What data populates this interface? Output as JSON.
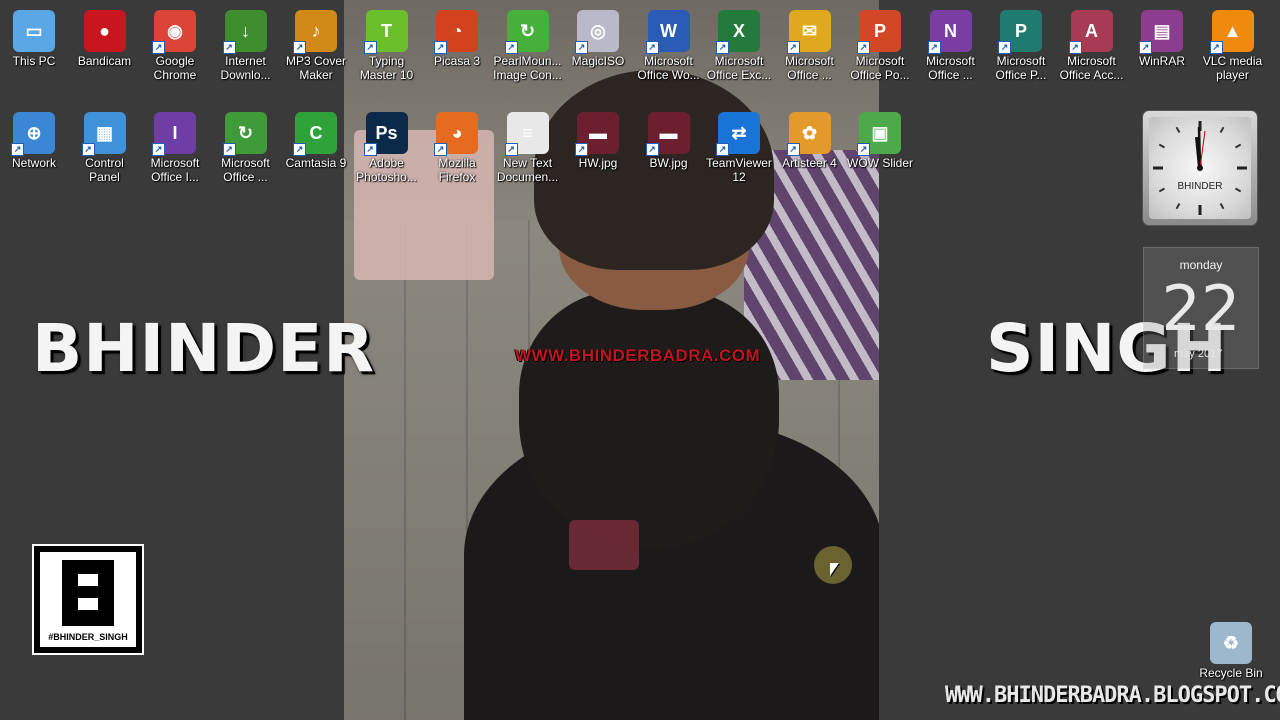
{
  "desktop": {
    "row1": [
      {
        "label": "This PC",
        "icon": "this-pc-icon",
        "color": "#5ba7e6",
        "glyph": "▭"
      },
      {
        "label": "Bandicam",
        "icon": "bandicam-icon",
        "color": "#c9151e",
        "glyph": "●"
      },
      {
        "label": "Google\nChrome",
        "icon": "chrome-icon",
        "color": "#db4437",
        "glyph": "◉"
      },
      {
        "label": "Internet\nDownlo...",
        "icon": "idm-icon",
        "color": "#3e8e2e",
        "glyph": "↓"
      },
      {
        "label": "MP3 Cover\nMaker",
        "icon": "mp3-cover-icon",
        "color": "#d18a18",
        "glyph": "♪"
      },
      {
        "label": "Typing\nMaster 10",
        "icon": "typing-master-icon",
        "color": "#6bbf2a",
        "glyph": "T"
      },
      {
        "label": "Picasa 3",
        "icon": "picasa-icon",
        "color": "#d2421c",
        "glyph": "◔"
      },
      {
        "label": "PearlMoun...\nImage Con...",
        "icon": "pearlmountain-icon",
        "color": "#45b13b",
        "glyph": "↻"
      },
      {
        "label": "MagicISO",
        "icon": "magiciso-icon",
        "color": "#b9b9c9",
        "glyph": "◎"
      },
      {
        "label": "Microsoft\nOffice Wo...",
        "icon": "word-icon",
        "color": "#2b5bb5",
        "glyph": "W"
      },
      {
        "label": "Microsoft\nOffice Exc...",
        "icon": "excel-icon",
        "color": "#237a3b",
        "glyph": "X"
      },
      {
        "label": "Microsoft\nOffice ...",
        "icon": "outlook-icon",
        "color": "#e0a81d",
        "glyph": "✉"
      },
      {
        "label": "Microsoft\nOffice Po...",
        "icon": "powerpoint-icon",
        "color": "#d24726",
        "glyph": "P"
      },
      {
        "label": "Microsoft\nOffice ...",
        "icon": "onenote-icon",
        "color": "#7a3da1",
        "glyph": "N"
      },
      {
        "label": "Microsoft\nOffice P...",
        "icon": "publisher-icon",
        "color": "#1f7b6e",
        "glyph": "P"
      },
      {
        "label": "Microsoft\nOffice Acc...",
        "icon": "access-icon",
        "color": "#a83b54",
        "glyph": "A"
      },
      {
        "label": "WinRAR",
        "icon": "winrar-icon",
        "color": "#8c3d8f",
        "glyph": "▤"
      },
      {
        "label": "VLC media\nplayer",
        "icon": "vlc-icon",
        "color": "#f08a0c",
        "glyph": "▲"
      }
    ],
    "row2": [
      {
        "label": "Network",
        "icon": "network-icon",
        "color": "#3b87d6",
        "glyph": "⊕"
      },
      {
        "label": "Control\nPanel",
        "icon": "control-panel-icon",
        "color": "#3f91d8",
        "glyph": "▦"
      },
      {
        "label": "Microsoft\nOffice I...",
        "icon": "infopath-icon",
        "color": "#6e3da6",
        "glyph": "I"
      },
      {
        "label": "Microsoft\nOffice ...",
        "icon": "office-upload-icon",
        "color": "#3f9a3a",
        "glyph": "↻"
      },
      {
        "label": "Camtasia 9",
        "icon": "camtasia-icon",
        "color": "#2fa33a",
        "glyph": "C"
      },
      {
        "label": "Adobe\nPhotosho...",
        "icon": "photoshop-icon",
        "color": "#0b2a4a",
        "glyph": "Ps"
      },
      {
        "label": "Mozilla\nFirefox",
        "icon": "firefox-icon",
        "color": "#e66a1f",
        "glyph": "◕"
      },
      {
        "label": "New Text\nDocumen...",
        "icon": "text-document-icon",
        "color": "#e8e8e8",
        "glyph": "≡"
      },
      {
        "label": "HW.jpg",
        "icon": "image-file-icon",
        "color": "#6b1f2f",
        "glyph": "▬"
      },
      {
        "label": "BW.jpg",
        "icon": "image-file-icon",
        "color": "#6b1f2f",
        "glyph": "▬"
      },
      {
        "label": "TeamViewer\n12",
        "icon": "teamviewer-icon",
        "color": "#1a73d6",
        "glyph": "⇄"
      },
      {
        "label": "Artisteer 4",
        "icon": "artisteer-icon",
        "color": "#e39a2a",
        "glyph": "✿"
      },
      {
        "label": "WOW Slider",
        "icon": "wow-slider-icon",
        "color": "#4caa4b",
        "glyph": "▣"
      }
    ],
    "recycle_bin": {
      "label": "Recycle Bin",
      "icon": "recycle-bin-icon",
      "color": "#9db7cc",
      "glyph": "♻"
    }
  },
  "overlay": {
    "left_name": "BHINDER",
    "right_name": "SINGH",
    "photo_watermark": "WWW.BHINDERBADRA.COM",
    "footer_url": "WWW.BHINDERBADRA.BLOGSPOT.COM",
    "logo_tag": "#BHINDER_SINGH"
  },
  "clock_gadget": {
    "brand": "BHINDER",
    "time": "11:59"
  },
  "calendar_gadget": {
    "weekday": "monday",
    "day": "22",
    "month": "may 2017"
  }
}
